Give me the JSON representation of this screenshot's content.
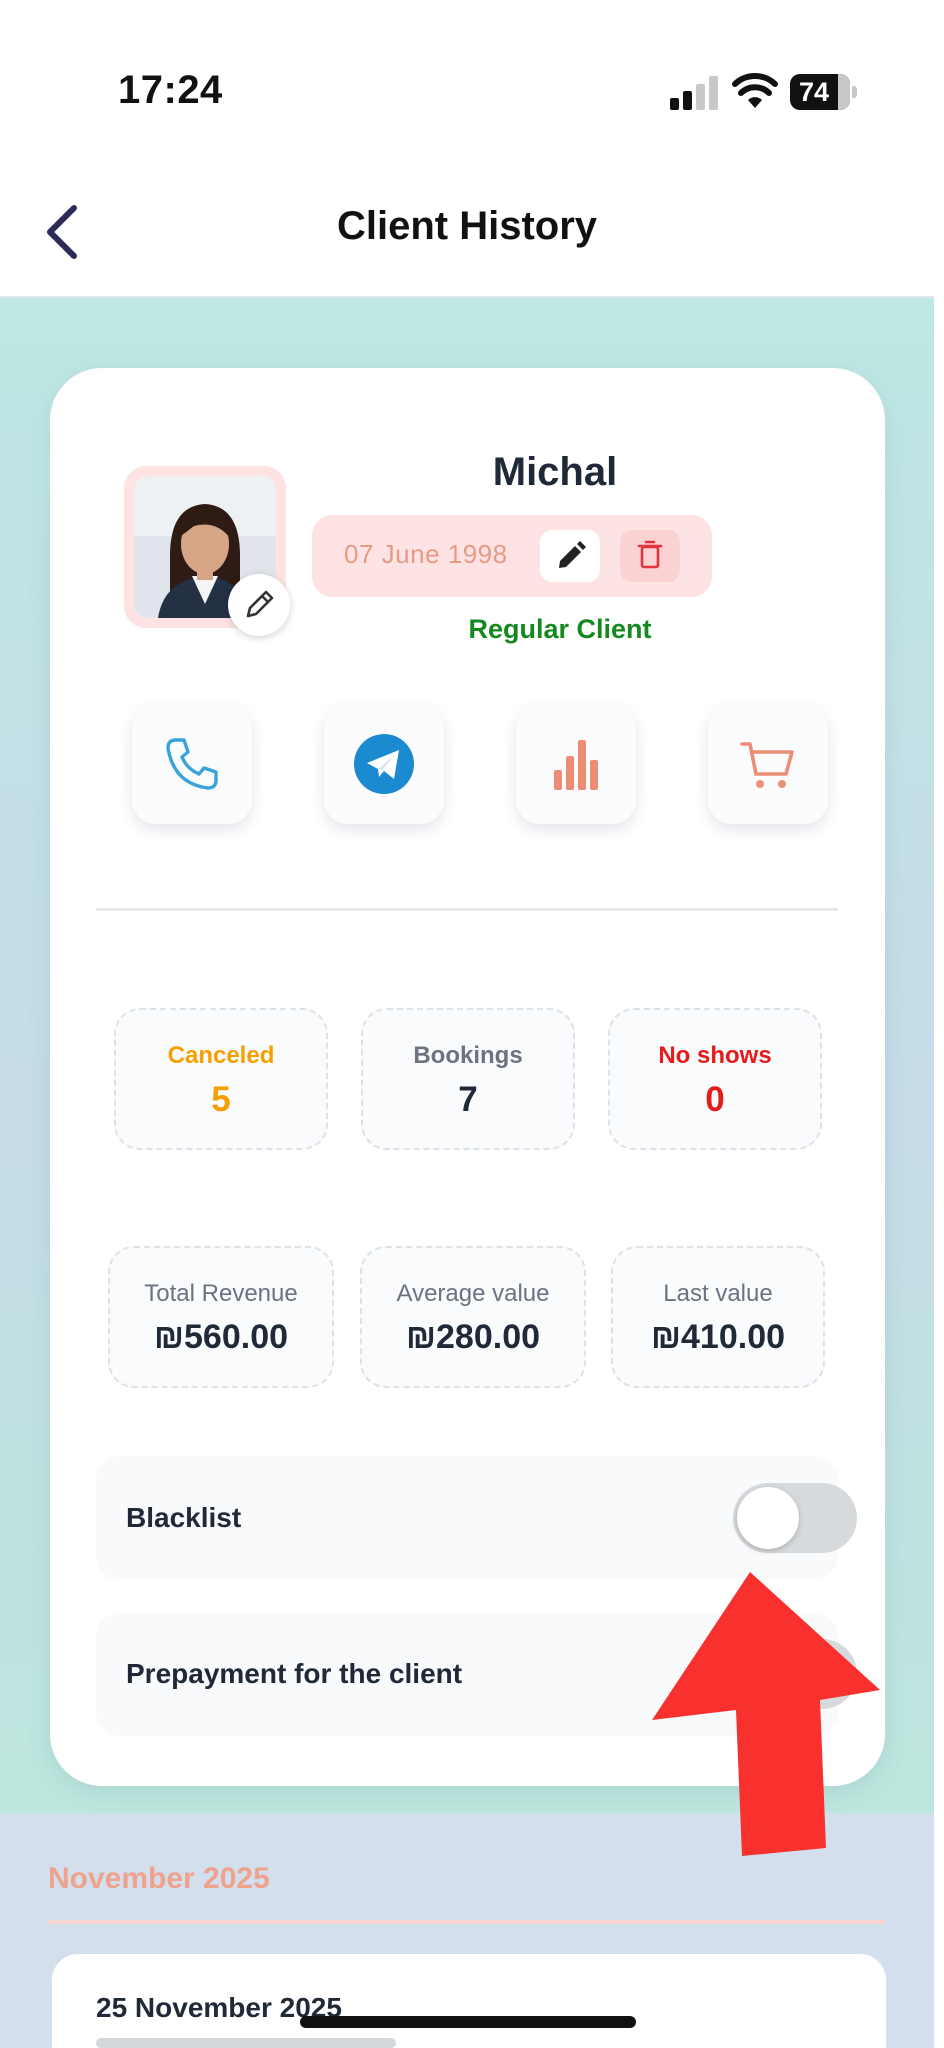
{
  "status_bar": {
    "time": "17:24",
    "battery": "74"
  },
  "header": {
    "title": "Client History",
    "back_icon": "chevron-left-icon"
  },
  "client": {
    "name": "Michal",
    "birth_date": "07 June 1998",
    "status": "Regular Client"
  },
  "actions": [
    {
      "icon": "phone-icon"
    },
    {
      "icon": "telegram-icon"
    },
    {
      "icon": "bar-chart-icon"
    },
    {
      "icon": "cart-icon"
    }
  ],
  "stats": {
    "canceled": {
      "label": "Canceled",
      "value": "5",
      "color": "#f5a000"
    },
    "bookings": {
      "label": "Bookings",
      "value": "7",
      "color": "#1f2937"
    },
    "no_shows": {
      "label": "No shows",
      "value": "0",
      "color": "#e21b1b"
    }
  },
  "revenue": {
    "total": {
      "label": "Total Revenue",
      "value": "₪560.00"
    },
    "average": {
      "label": "Average value",
      "value": "₪280.00"
    },
    "last": {
      "label": "Last value",
      "value": "₪410.00"
    }
  },
  "toggles": {
    "blacklist": {
      "label": "Blacklist",
      "on": false
    },
    "prepayment": {
      "label": "Prepayment for the client",
      "on": false
    }
  },
  "history": {
    "month": "November 2025",
    "first_booking_date": "25 November 2025"
  },
  "colors": {
    "accent_salmon": "#eea38c",
    "status_green": "#15891f",
    "telegram_blue": "#1c8ad0"
  }
}
